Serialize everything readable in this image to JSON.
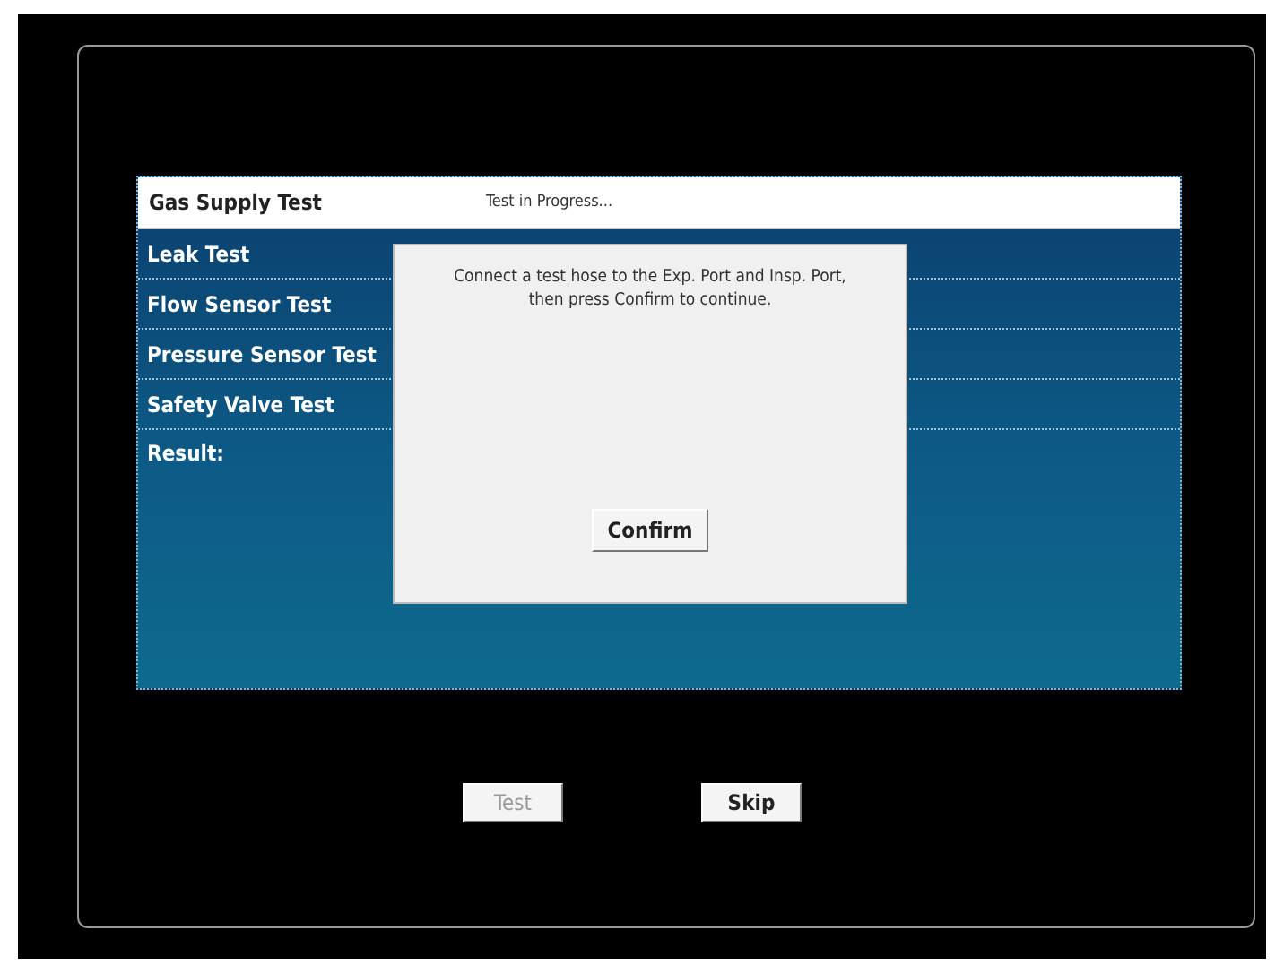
{
  "header": {
    "title": "Gas Supply Test",
    "status": "Test in Progress..."
  },
  "tests": [
    {
      "label": "Leak Test"
    },
    {
      "label": "Flow Sensor Test"
    },
    {
      "label": "Pressure Sensor Test"
    },
    {
      "label": "Safety Valve Test"
    },
    {
      "label": "Result:"
    }
  ],
  "dialog": {
    "message": "Connect a test hose to the Exp. Port and Insp. Port,\nthen press Confirm to continue.",
    "button": "Confirm"
  },
  "buttons": [
    {
      "label": "Test",
      "disabled": true
    },
    {
      "label": "Skip",
      "disabled": false
    }
  ]
}
